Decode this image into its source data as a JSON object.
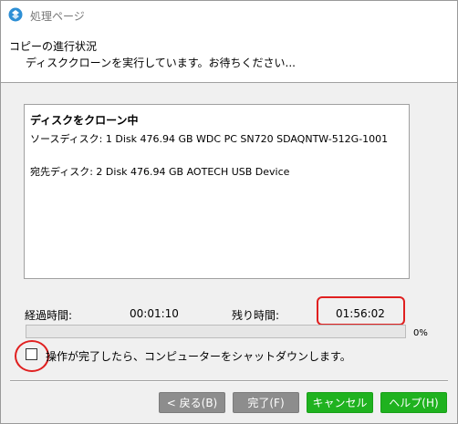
{
  "window": {
    "title": "処理ページ"
  },
  "header": {
    "title": "コピーの進行状況",
    "subtitle": "ディスククローンを実行しています。お待ちください..."
  },
  "info": {
    "heading": "ディスクをクローン中",
    "source": "ソースディスク: 1 Disk 476.94 GB WDC PC SN720 SDAQNTW-512G-1001",
    "destination": "宛先ディスク: 2 Disk 476.94 GB AOTECH USB Device"
  },
  "time": {
    "elapsed_label": "経過時間:",
    "elapsed_value": "00:01:10",
    "remaining_label": "残り時間:",
    "remaining_value": "01:56:02"
  },
  "progress": {
    "percent_text": "0%",
    "fraction": 0
  },
  "shutdown_option": {
    "label": "操作が完了したら、コンピューターをシャットダウンします。",
    "checked": false
  },
  "buttons": {
    "back": "< 戻る(B)",
    "finish": "完了(F)",
    "cancel": "キャンセル",
    "help": "ヘルプ(H)"
  },
  "colors": {
    "highlight": "#e02020",
    "button_green": "#1fb21f",
    "button_disabled": "#8d8d8d"
  },
  "icons": {
    "app": "app-logo-icon"
  }
}
